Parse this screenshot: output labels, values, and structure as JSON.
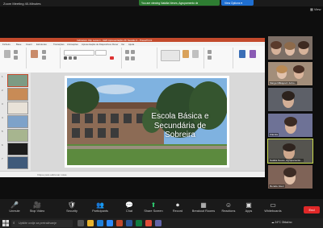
{
  "window": {
    "title": "Zoom Meeting 40-Minutes"
  },
  "share_banner": {
    "text": "You are viewing Natália Neves, Agrupamento de E...'s screen"
  },
  "view_options": {
    "label": "View Options ▾"
  },
  "view_button": {
    "label": "View"
  },
  "powerpoint": {
    "title": "Indicators Clip Lesson - GE5 Apresentação 2K Sessão 3 - PowerPoint",
    "tabs": [
      "Ficheiro",
      "Base",
      "Inserir",
      "Estruturas",
      "Transições",
      "Animações",
      "Apresentação de Diapositivos",
      "Rever",
      "Ver",
      "Ajuda"
    ],
    "slide_numbers": [
      "1",
      "2",
      "3",
      "4",
      "5",
      "6",
      "7"
    ],
    "slide_title": [
      "Escola Básica e",
      "Secundária de",
      "Sobreira"
    ],
    "notes_placeholder": "Clique para adicionar notas"
  },
  "participants": [
    {
      "name": "",
      "color": "#8a7a70"
    },
    {
      "name": "Marga Miłkajević Jurko...",
      "color": "#a08874"
    },
    {
      "name": "",
      "color": "#6d6f7a"
    },
    {
      "name": "Zdenka",
      "color": "#7a7e9e"
    },
    {
      "name": "Natália Neves, Agrupamento...",
      "color": "#5e5d58",
      "active": true
    },
    {
      "name": "Renata Javor",
      "color": "#8a6b5e"
    }
  ],
  "toolbar": {
    "buttons": [
      {
        "name": "unmute",
        "label": "Unmute",
        "icon": "🎤"
      },
      {
        "name": "stop-video",
        "label": "Stop Video",
        "icon": "🎥"
      },
      {
        "name": "security",
        "label": "Security",
        "icon": "🛡"
      },
      {
        "name": "participants",
        "label": "Participants",
        "icon": "👥"
      },
      {
        "name": "chat",
        "label": "Chat",
        "icon": "💬"
      },
      {
        "name": "share-screen",
        "label": "Share Screen",
        "icon": "⬆"
      },
      {
        "name": "record",
        "label": "Record",
        "icon": "⏺"
      },
      {
        "name": "breakout-rooms",
        "label": "Breakout Rooms",
        "icon": "▦"
      },
      {
        "name": "reactions",
        "label": "Reactions",
        "icon": "☺"
      },
      {
        "name": "apps",
        "label": "Apps",
        "icon": "▣"
      },
      {
        "name": "whiteboards",
        "label": "Whiteboards",
        "icon": "▭"
      }
    ],
    "end_label": "End",
    "share_color": "#2ecc71"
  },
  "taskbar": {
    "search_placeholder": "Upišite ovdje za pretraživanje",
    "tray_text": "24°C Oblačno"
  }
}
